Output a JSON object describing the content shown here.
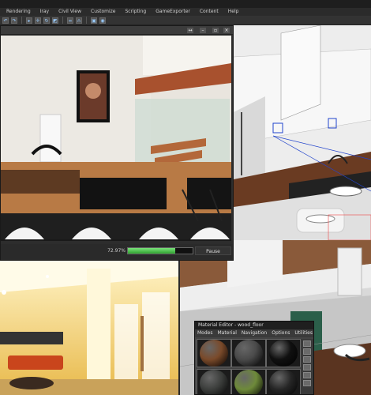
{
  "window": {
    "title": ""
  },
  "menu": [
    "Rendering",
    "Iray",
    "Civil View",
    "Customize",
    "Scripting",
    "GameExporter",
    "Content",
    "Help"
  ],
  "toolbar": {
    "icons": [
      "undo-icon",
      "redo-icon",
      "select-icon",
      "move-icon",
      "rotate-icon",
      "scale-icon",
      "link-icon",
      "snap-icon",
      "render-setup-icon",
      "render-icon"
    ]
  },
  "render_window": {
    "progress_text": "72.97%",
    "progress": 0.7297,
    "pause_label": "Pause"
  },
  "material_editor": {
    "title": "Material Editor - wood_floor",
    "menu": [
      "Modes",
      "Material",
      "Navigation",
      "Options",
      "Utilities"
    ],
    "spheres": [
      {
        "name": "wood-sphere",
        "color": "#7a4a2a"
      },
      {
        "name": "dark-grey-sphere",
        "color": "#4a4a4a"
      },
      {
        "name": "black-sphere",
        "color": "#101010"
      },
      {
        "name": "grey-sphere",
        "color": "#3c3e3c"
      },
      {
        "name": "plant-sphere",
        "color": "#6e8a3a"
      },
      {
        "name": "dark-sphere",
        "color": "#262626"
      }
    ]
  },
  "colors": {
    "accent": "#2fa22f",
    "ui_dark": "#2b2b2b",
    "viewport_yellow": "#f1d36a"
  }
}
